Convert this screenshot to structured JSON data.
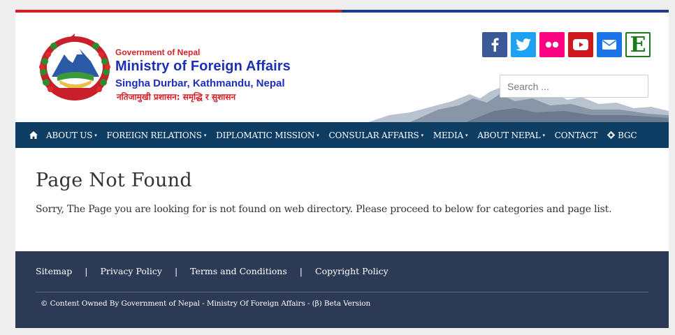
{
  "header": {
    "gov_text": "Government of Nepal",
    "ministry": "Ministry of Foreign Affairs",
    "address": "Singha Durbar, Kathmandu, Nepal",
    "motto": "नतिजामुखी प्रशासन: समृद्धि र सुशासन"
  },
  "socials": [
    {
      "icon": "facebook-icon",
      "color": "#3b5998"
    },
    {
      "icon": "twitter-icon",
      "color": "#1da1f2"
    },
    {
      "icon": "flickr-icon",
      "color": "#ff0084"
    },
    {
      "icon": "youtube-icon",
      "color": "#cc181e"
    },
    {
      "icon": "mail-icon",
      "color": "#1a73e8"
    },
    {
      "icon": "ekantipur-e-icon",
      "label": "E",
      "color": "#1f7a1f"
    }
  ],
  "search": {
    "placeholder": "Search ..."
  },
  "nav": {
    "items": [
      {
        "label": "ABOUT US",
        "caret": "▾"
      },
      {
        "label": "FOREIGN RELATIONS",
        "caret": "▾"
      },
      {
        "label": "DIPLOMATIC MISSION",
        "caret": "▾"
      },
      {
        "label": "CONSULAR AFFAIRS",
        "caret": "▾"
      },
      {
        "label": "MEDIA",
        "caret": "▾"
      },
      {
        "label": "ABOUT NEPAL",
        "caret": "▾"
      },
      {
        "label": "CONTACT"
      },
      {
        "label": "BGC"
      }
    ]
  },
  "main": {
    "title": "Page Not Found",
    "message": "Sorry, The Page you are looking for is not found on web directory. Please proceed to below for categories and page list."
  },
  "footer": {
    "links": [
      "Sitemap",
      "Privacy Policy",
      "Terms and Conditions",
      "Copyright Policy"
    ],
    "separator": "|",
    "copyright": "© Content Owned By Government of Nepal - Ministry Of Foreign Affairs - (β) Beta Version"
  },
  "colors": {
    "nav_bg": "#0e3d63",
    "footer_bg": "#2d3a55",
    "brand_red": "#d71f26",
    "brand_blue": "#1e2fb5"
  }
}
